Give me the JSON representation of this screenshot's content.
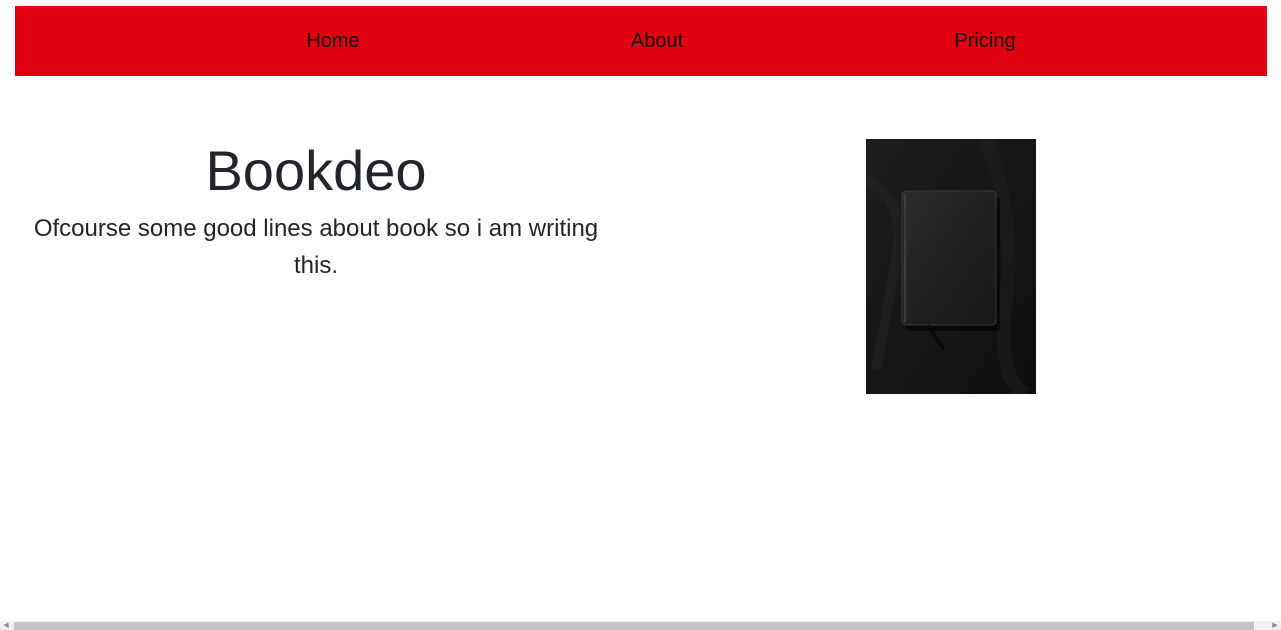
{
  "nav": {
    "items": [
      {
        "label": "Home"
      },
      {
        "label": "About"
      },
      {
        "label": "Pricing"
      }
    ],
    "background_color": "#e10012"
  },
  "hero": {
    "title": "Bookdeo",
    "subtitle": "Ofcourse some good lines about book so i am writing this.",
    "image": {
      "icon": "book-photo",
      "background_color": "#111111"
    }
  },
  "scrollbar": {
    "left_arrow": "◀",
    "right_arrow": "▶"
  }
}
